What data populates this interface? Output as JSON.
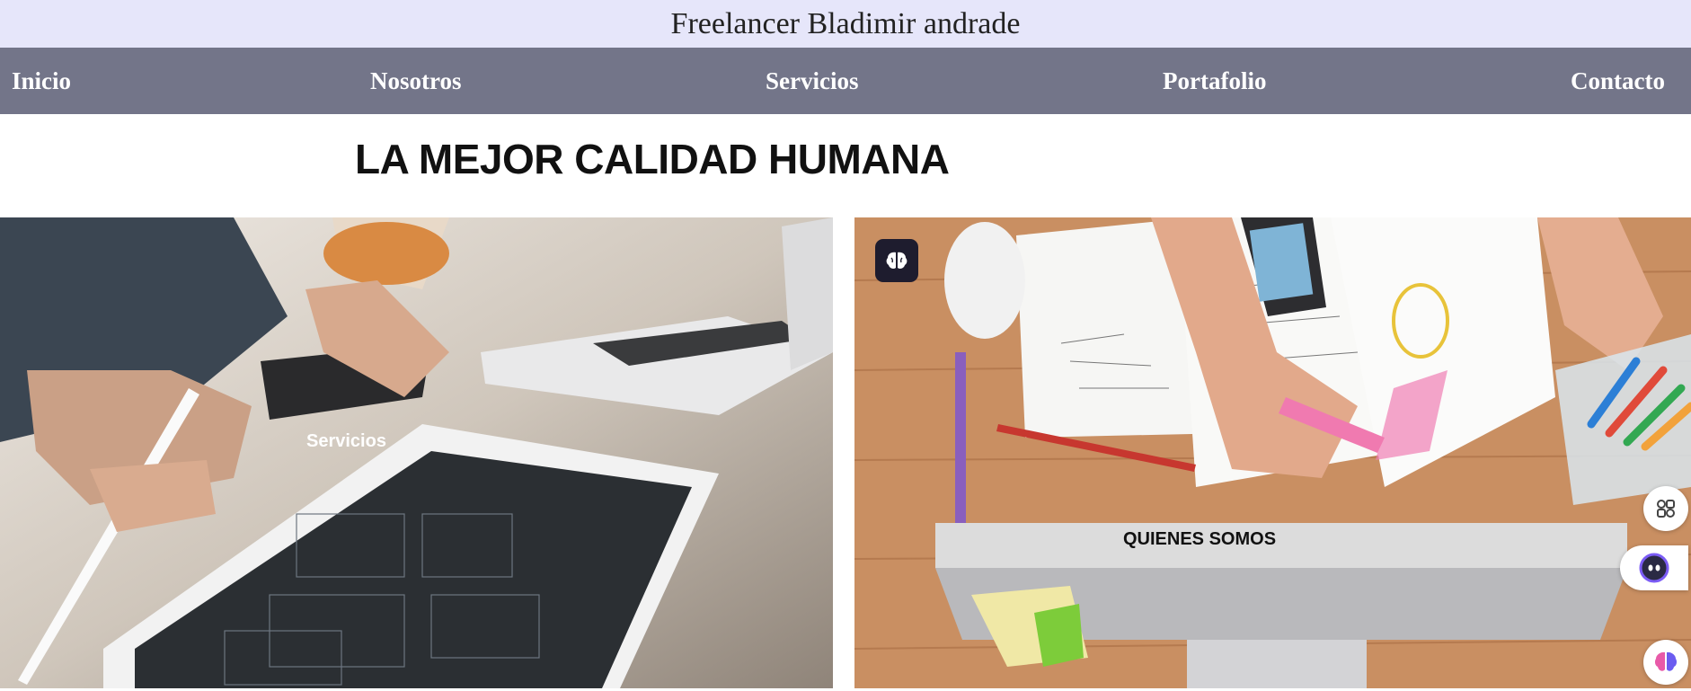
{
  "header": {
    "title": "Freelancer Bladimir andrade"
  },
  "nav": {
    "items": [
      {
        "label": "Inicio"
      },
      {
        "label": "Nosotros"
      },
      {
        "label": "Servicios"
      },
      {
        "label": "Portafolio"
      },
      {
        "label": "Contacto"
      }
    ]
  },
  "hero": {
    "headline": "LA MEJOR CALIDAD HUMANA"
  },
  "cards": [
    {
      "label": "Servicios"
    },
    {
      "label": "QUIENES SOMOS"
    }
  ],
  "floating": {
    "icons": [
      "brain-icon",
      "grid-icon",
      "chat-face-icon",
      "brain-colorful-icon"
    ]
  },
  "colors": {
    "title_bg": "#e6e6fa",
    "nav_bg": "#737589",
    "nav_text": "#ffffff",
    "badge_bg": "#1e1c2e"
  }
}
